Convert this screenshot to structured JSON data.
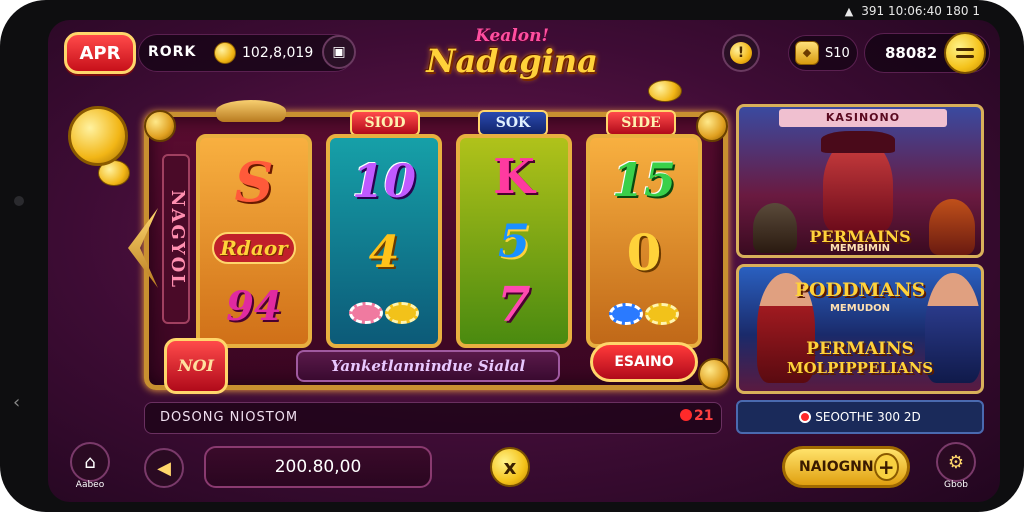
{
  "system_status": {
    "text": "391 10:06:40 180 1"
  },
  "topbar": {
    "apr_label": "APR",
    "username": "RORK",
    "coin_balance": "102,8,019",
    "game_title_sub": "Kealon!",
    "game_title_main": "Nadagina",
    "bonus_value": "S10",
    "balance_value": "88082"
  },
  "slot": {
    "side_text": "NAGYOL",
    "reel_labels": [
      "SIOD",
      "SOK",
      "SIDE"
    ],
    "reels": [
      {
        "symbols": [
          "S",
          "Rdaor",
          "94"
        ]
      },
      {
        "symbols": [
          "10",
          "4"
        ]
      },
      {
        "symbols": [
          "K",
          "5",
          "7"
        ]
      },
      {
        "symbols": [
          "15",
          "0"
        ]
      }
    ],
    "slogan": "Yanketlannindue Sialal",
    "left_button_label": "NOI",
    "right_button_label": "ESAINO"
  },
  "promos": {
    "top": {
      "title": "KASINONO",
      "big_text": "PERMAINS",
      "small_text": "MEMBIMIN"
    },
    "bottom": {
      "title_line": "PODDMANS",
      "title_sub": "MEMUDON",
      "big_line1": "PERMAINS",
      "big_line2": "MOLPIPPELIANS"
    }
  },
  "status_bar": {
    "text": "DOSONG NIOSTOM",
    "count": "21"
  },
  "promo_status": {
    "text": "SEOOTHE 300 2D"
  },
  "bottom": {
    "home_caption": "Aabeo",
    "bet_value": "200.80,00",
    "spin_icon": "x",
    "action_label": "NAIOGNN",
    "action_plus": "+",
    "settings_caption": "Gbob"
  },
  "colors": {
    "background": "#3d0c34",
    "accent_gold": "#ffd23a",
    "accent_red": "#c7101a"
  }
}
